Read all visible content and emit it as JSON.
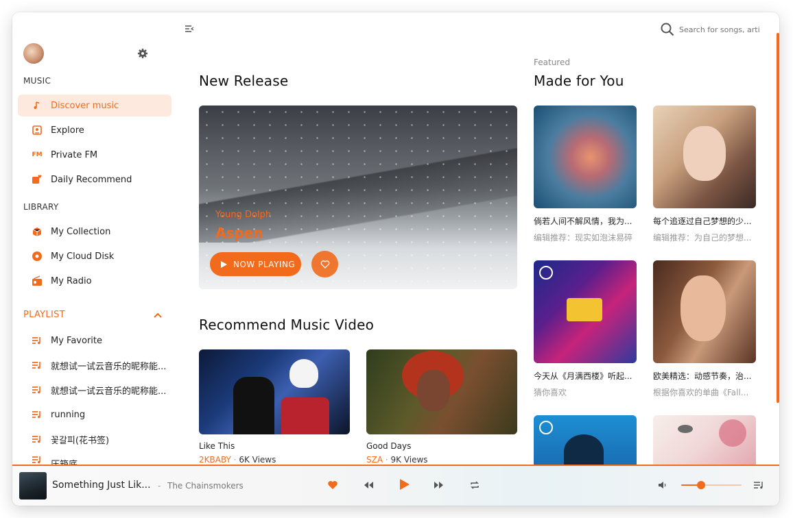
{
  "colors": {
    "accent": "#f26b1d",
    "accent_light": "#fde9de",
    "text": "#222222",
    "muted": "#999999"
  },
  "toolbar": {
    "search_placeholder": "Search for songs, artis"
  },
  "sidebar": {
    "music_title": "MUSIC",
    "library_title": "LIBRARY",
    "playlist_title": "PLAYLIST",
    "music_items": [
      {
        "label": "Discover music",
        "icon": "music-note-icon",
        "active": true
      },
      {
        "label": "Explore",
        "icon": "explore-icon"
      },
      {
        "label": "Private FM",
        "icon": "fm-icon",
        "icon_text": "FM"
      },
      {
        "label": "Daily Recommend",
        "icon": "calendar-heart-icon"
      }
    ],
    "library_items": [
      {
        "label": "My Collection",
        "icon": "box-icon"
      },
      {
        "label": "My Cloud Disk",
        "icon": "disc-icon"
      },
      {
        "label": "My Radio",
        "icon": "radio-icon"
      }
    ],
    "playlists": [
      {
        "label": "My Favorite"
      },
      {
        "label": "就想试一试云音乐的昵称能..."
      },
      {
        "label": "就想试一试云音乐的昵称能..."
      },
      {
        "label": "running"
      },
      {
        "label": "꽃갈피(花书签)"
      },
      {
        "label": "压箱底"
      }
    ]
  },
  "main": {
    "new_release_title": "New Release",
    "hero": {
      "artist": "Young Dolph",
      "title": "Aspen",
      "now_playing_label": "NOW PLAYING"
    },
    "mv_title": "Recommend Music Video",
    "videos": [
      {
        "title": "Like This",
        "artist": "2KBABY",
        "views": "6K Views"
      },
      {
        "title": "Good Days",
        "artist": "SZA",
        "views": "9K Views"
      }
    ],
    "featured_label": "Featured",
    "made_for_you_title": "Made for You",
    "playlists": [
      {
        "title": "倘若人间不解风情，我为...",
        "subtitle": "编辑推荐：现实如泡沫易碎"
      },
      {
        "title": "每个追逐过自己梦想的少...",
        "subtitle": "编辑推荐：为自己的梦想..."
      },
      {
        "title": "今天从《月满西楼》听起...",
        "subtitle": "猜你喜欢"
      },
      {
        "title": "欧美精选：动感节奏，治...",
        "subtitle": "根据你喜欢的单曲《Fall..."
      }
    ]
  },
  "player": {
    "track_title": "Something Just Lik...",
    "separator": "-",
    "artist": "The Chainsmokers",
    "volume": 0.33
  }
}
